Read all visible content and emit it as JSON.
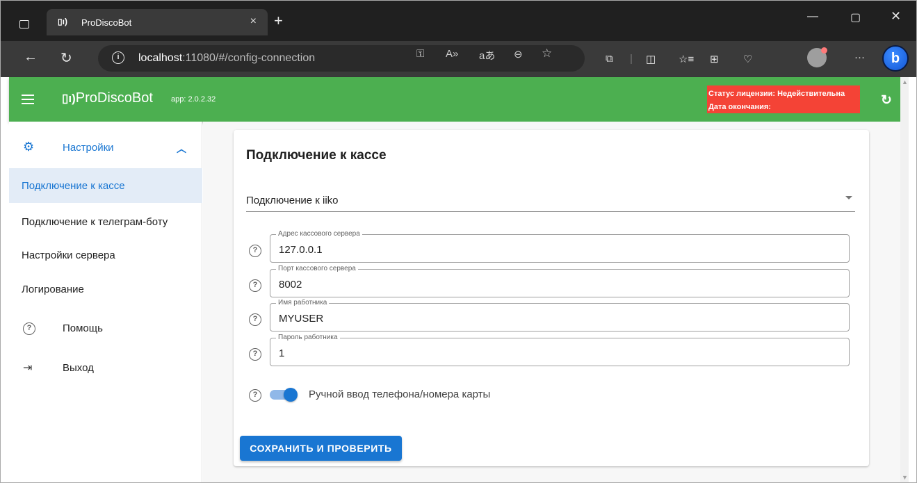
{
  "browser": {
    "tab_title": "ProDiscoBot",
    "tab_close": "×",
    "new_tab": "+",
    "url_host": "localhost",
    "url_rest": ":11080/#/config-connection",
    "icons": [
      "back-icon",
      "reload-icon",
      "info-icon",
      "key-icon",
      "read-aloud-icon",
      "translate-icon",
      "zoom-out-icon",
      "favorite-star-icon",
      "extensions-icon",
      "split-screen-icon",
      "favorites-icon",
      "collections-icon",
      "browser-essentials-icon",
      "profile-icon",
      "more-icon",
      "bing-copilot-icon"
    ]
  },
  "header": {
    "brand": "ProDiscoBot",
    "app_version": "app: 2.0.2.32",
    "license_status": "Статус лицензии: Недействительна",
    "license_expiry": "Дата окончания:",
    "colors": {
      "appbar": "#4caf50",
      "license_badge": "#f44336"
    }
  },
  "sidebar": {
    "section_label": "Настройки",
    "items": [
      {
        "label": "Подключение к кассе",
        "active": true
      },
      {
        "label": "Подключение к телеграм-боту",
        "active": false
      },
      {
        "label": "Настройки сервера",
        "active": false
      },
      {
        "label": "Логирование",
        "active": false
      }
    ],
    "help_label": "Помощь",
    "logout_label": "Выход",
    "accent": "#1976d2"
  },
  "main": {
    "card_title": "Подключение к кассе",
    "connection_select": "Подключение к iiko",
    "fields": [
      {
        "label": "Адрес кассового сервера",
        "value": "127.0.0.1"
      },
      {
        "label": "Порт кассового сервера",
        "value": "8002"
      },
      {
        "label": "Имя работника",
        "value": "MYUSER"
      },
      {
        "label": "Пароль работника",
        "value": "1"
      }
    ],
    "manual_input_toggle": {
      "label": "Ручной ввод телефона/номера карты",
      "checked": true
    },
    "save_button": "СОХРАНИТЬ И ПРОВЕРИТЬ"
  }
}
